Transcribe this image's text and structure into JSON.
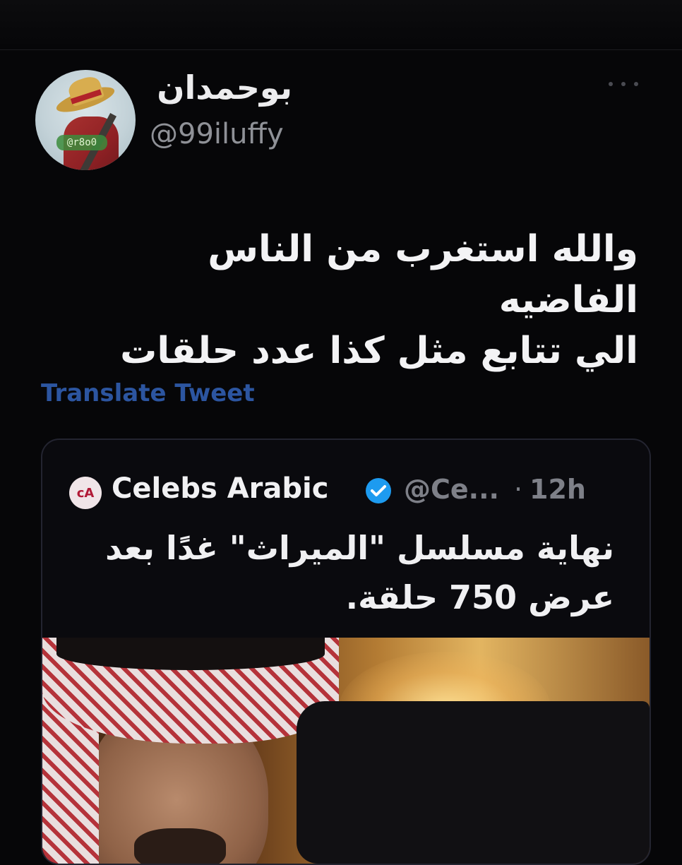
{
  "tweet": {
    "display_name": "بوحمدان",
    "handle": "@99iluffy",
    "avatar_badge": "@r8o0",
    "text_lines": [
      "والله استغرب من الناس الفاضيه",
      "الي تتابع مثل كذا عدد حلقات"
    ],
    "translate_label": "Translate Tweet"
  },
  "quoted": {
    "logo_text": "cA",
    "name": "Celebs Arabic",
    "handle": "@Ce...",
    "dot": "·",
    "time": "12h",
    "text_lines": [
      "نهاية مسلسل \"الميراث\" غدًا بعد",
      "عرض 750 حلقة."
    ]
  },
  "colors": {
    "background": "#060608",
    "link": "#2c55a0",
    "verified": "#1d9bf0"
  }
}
